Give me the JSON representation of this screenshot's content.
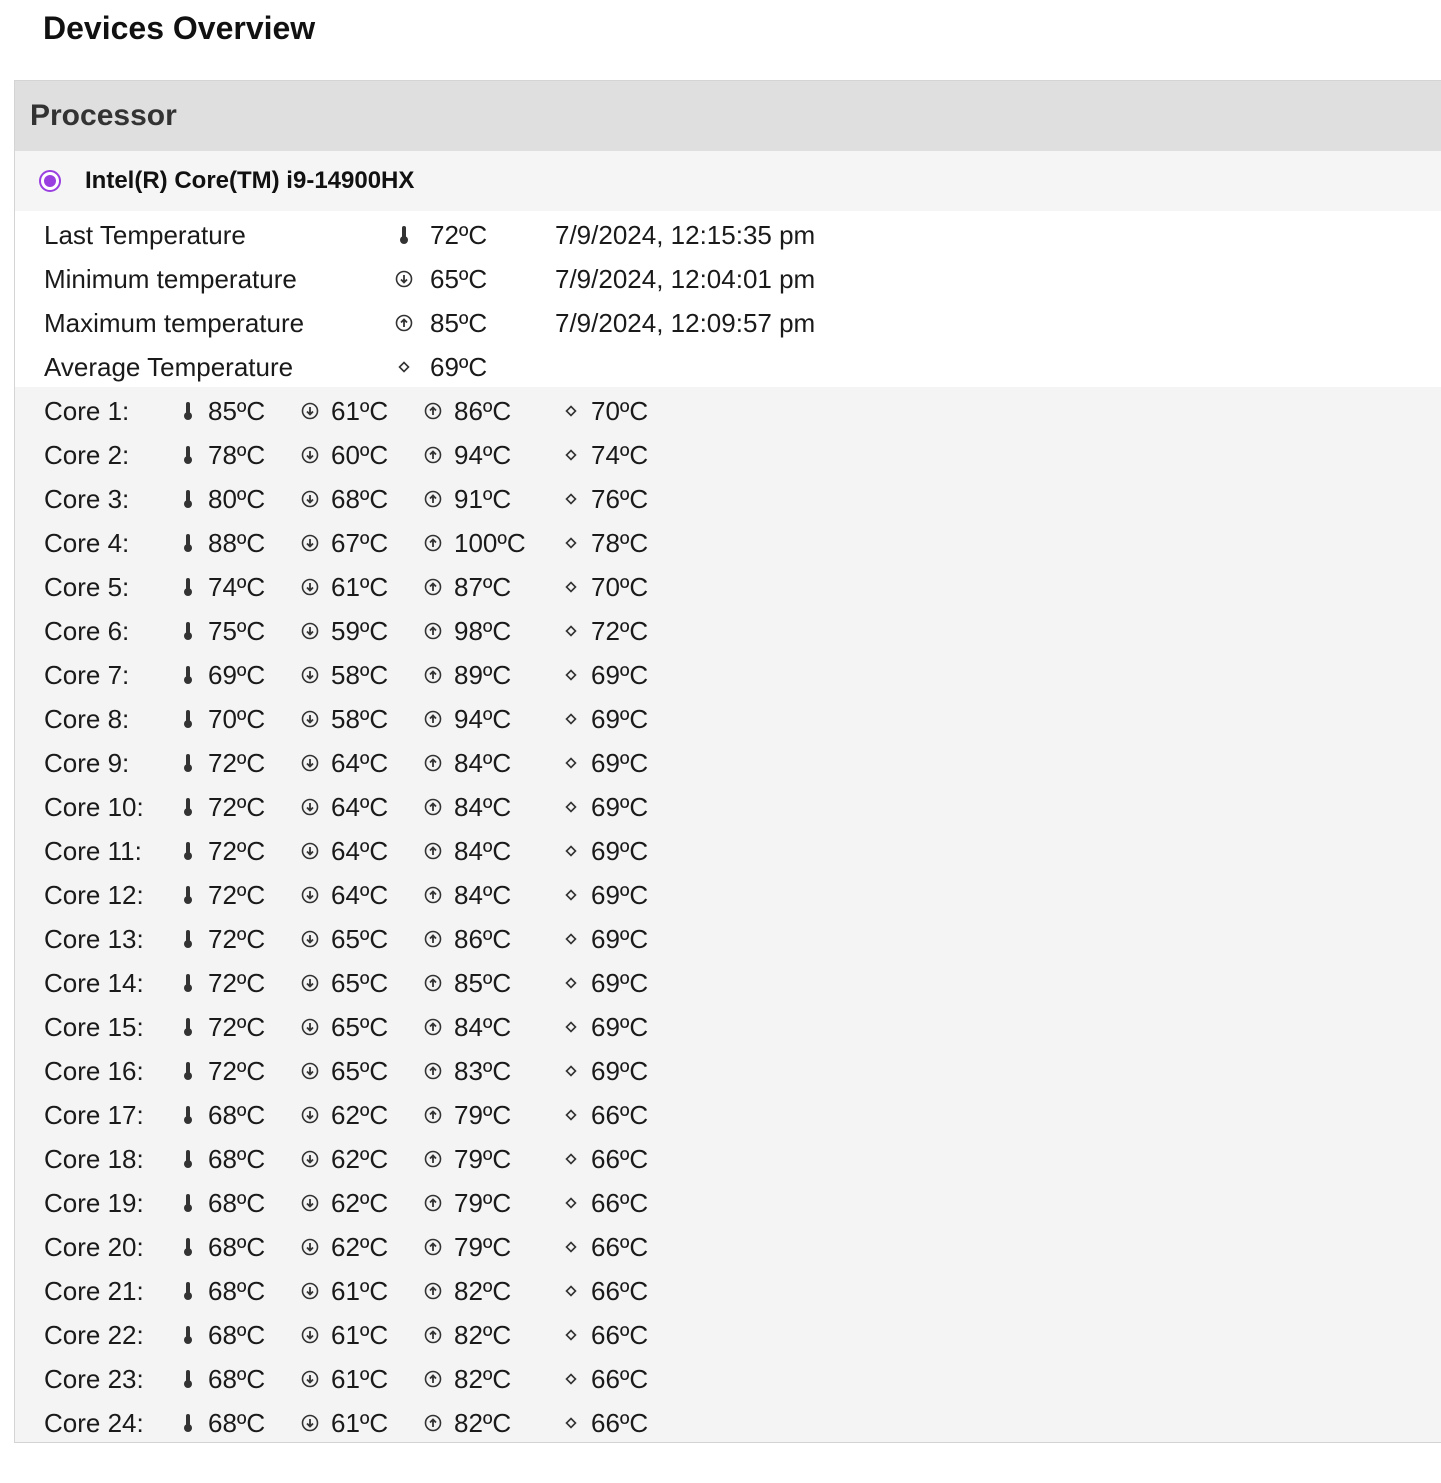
{
  "page": {
    "title": "Devices Overview"
  },
  "section": {
    "title": "Processor"
  },
  "device": {
    "name": "Intel(R) Core(TM) i9-14900HX",
    "accent": "#9a3fe0"
  },
  "summary": {
    "last": {
      "label": "Last Temperature",
      "value": "72ºC",
      "time": "7/9/2024, 12:15:35 pm",
      "icon": "thermometer-icon"
    },
    "min": {
      "label": "Minimum temperature",
      "value": "65ºC",
      "time": "7/9/2024, 12:04:01 pm",
      "icon": "arrow-down-circle-icon"
    },
    "max": {
      "label": "Maximum temperature",
      "value": "85ºC",
      "time": "7/9/2024, 12:09:57 pm",
      "icon": "arrow-up-circle-icon"
    },
    "avg": {
      "label": "Average Temperature",
      "value": "69ºC",
      "icon": "diamond-icon"
    }
  },
  "cores": [
    {
      "label": "Core 1:",
      "cur": "85ºC",
      "min": "61ºC",
      "max": "86ºC",
      "avg": "70ºC"
    },
    {
      "label": "Core 2:",
      "cur": "78ºC",
      "min": "60ºC",
      "max": "94ºC",
      "avg": "74ºC"
    },
    {
      "label": "Core 3:",
      "cur": "80ºC",
      "min": "68ºC",
      "max": "91ºC",
      "avg": "76ºC"
    },
    {
      "label": "Core 4:",
      "cur": "88ºC",
      "min": "67ºC",
      "max": "100ºC",
      "avg": "78ºC"
    },
    {
      "label": "Core 5:",
      "cur": "74ºC",
      "min": "61ºC",
      "max": "87ºC",
      "avg": "70ºC"
    },
    {
      "label": "Core 6:",
      "cur": "75ºC",
      "min": "59ºC",
      "max": "98ºC",
      "avg": "72ºC"
    },
    {
      "label": "Core 7:",
      "cur": "69ºC",
      "min": "58ºC",
      "max": "89ºC",
      "avg": "69ºC"
    },
    {
      "label": "Core 8:",
      "cur": "70ºC",
      "min": "58ºC",
      "max": "94ºC",
      "avg": "69ºC"
    },
    {
      "label": "Core 9:",
      "cur": "72ºC",
      "min": "64ºC",
      "max": "84ºC",
      "avg": "69ºC"
    },
    {
      "label": "Core 10:",
      "cur": "72ºC",
      "min": "64ºC",
      "max": "84ºC",
      "avg": "69ºC"
    },
    {
      "label": "Core 11:",
      "cur": "72ºC",
      "min": "64ºC",
      "max": "84ºC",
      "avg": "69ºC"
    },
    {
      "label": "Core 12:",
      "cur": "72ºC",
      "min": "64ºC",
      "max": "84ºC",
      "avg": "69ºC"
    },
    {
      "label": "Core 13:",
      "cur": "72ºC",
      "min": "65ºC",
      "max": "86ºC",
      "avg": "69ºC"
    },
    {
      "label": "Core 14:",
      "cur": "72ºC",
      "min": "65ºC",
      "max": "85ºC",
      "avg": "69ºC"
    },
    {
      "label": "Core 15:",
      "cur": "72ºC",
      "min": "65ºC",
      "max": "84ºC",
      "avg": "69ºC"
    },
    {
      "label": "Core 16:",
      "cur": "72ºC",
      "min": "65ºC",
      "max": "83ºC",
      "avg": "69ºC"
    },
    {
      "label": "Core 17:",
      "cur": "68ºC",
      "min": "62ºC",
      "max": "79ºC",
      "avg": "66ºC"
    },
    {
      "label": "Core 18:",
      "cur": "68ºC",
      "min": "62ºC",
      "max": "79ºC",
      "avg": "66ºC"
    },
    {
      "label": "Core 19:",
      "cur": "68ºC",
      "min": "62ºC",
      "max": "79ºC",
      "avg": "66ºC"
    },
    {
      "label": "Core 20:",
      "cur": "68ºC",
      "min": "62ºC",
      "max": "79ºC",
      "avg": "66ºC"
    },
    {
      "label": "Core 21:",
      "cur": "68ºC",
      "min": "61ºC",
      "max": "82ºC",
      "avg": "66ºC"
    },
    {
      "label": "Core 22:",
      "cur": "68ºC",
      "min": "61ºC",
      "max": "82ºC",
      "avg": "66ºC"
    },
    {
      "label": "Core 23:",
      "cur": "68ºC",
      "min": "61ºC",
      "max": "82ºC",
      "avg": "66ºC"
    },
    {
      "label": "Core 24:",
      "cur": "68ºC",
      "min": "61ºC",
      "max": "82ºC",
      "avg": "66ºC"
    }
  ]
}
